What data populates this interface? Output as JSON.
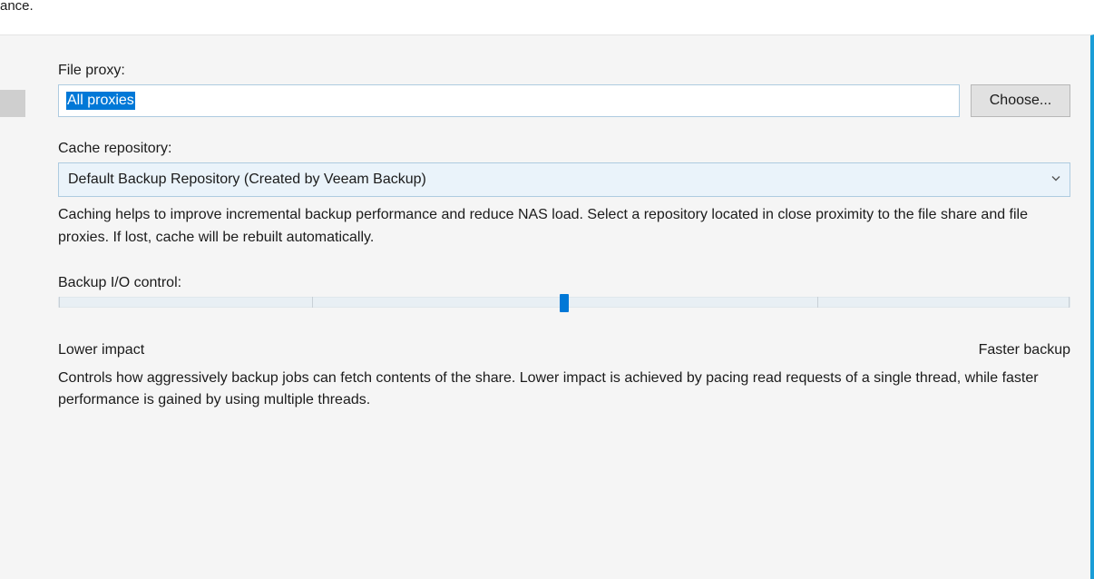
{
  "fragment_text": "ance.",
  "file_proxy": {
    "label": "File proxy:",
    "value": "All proxies",
    "choose_button": "Choose..."
  },
  "cache_repo": {
    "label": "Cache repository:",
    "selected": "Default Backup Repository (Created by Veeam Backup)",
    "help": "Caching helps to improve incremental backup performance and reduce NAS load. Select a repository located in close proximity to the file share and file proxies. If lost, cache will be rebuilt automatically."
  },
  "io_control": {
    "label": "Backup I/O control:",
    "min_label": "Lower impact",
    "max_label": "Faster backup",
    "value_percent": 50,
    "help": "Controls how aggressively backup jobs can fetch contents of the share. Lower impact is achieved by pacing read requests of a single thread, while faster performance is gained by using multiple threads."
  }
}
